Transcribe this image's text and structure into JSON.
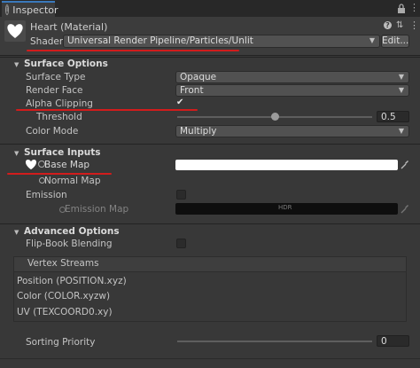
{
  "tab": {
    "title": "Inspector"
  },
  "header": {
    "material_name": "Heart (Material)",
    "shader_label": "Shader",
    "shader_value": "Universal Render Pipeline/Particles/Unlit",
    "edit_button": "Edit..."
  },
  "surface_options": {
    "title": "Surface Options",
    "surface_type_label": "Surface Type",
    "surface_type_value": "Opaque",
    "render_face_label": "Render Face",
    "render_face_value": "Front",
    "alpha_clipping_label": "Alpha Clipping",
    "alpha_clipping_checked": "✔",
    "threshold_label": "Threshold",
    "threshold_value": "0.5",
    "threshold_fraction": 0.5,
    "color_mode_label": "Color Mode",
    "color_mode_value": "Multiply"
  },
  "surface_inputs": {
    "title": "Surface Inputs",
    "base_map_label": "Base Map",
    "normal_map_label": "Normal Map",
    "emission_label": "Emission",
    "emission_map_label": "Emission Map",
    "hdr_label": "HDR"
  },
  "advanced_options": {
    "title": "Advanced Options",
    "flipbook_label": "Flip-Book Blending",
    "vertex_streams_title": "Vertex Streams",
    "streams": [
      "Position (POSITION.xyz)",
      "Color (COLOR.xyzw)",
      "UV (TEXCOORD0.xy)"
    ],
    "sorting_priority_label": "Sorting Priority",
    "sorting_priority_value": "0"
  },
  "colors": {
    "annotation": "#d21c1c",
    "tab_accent": "#3a79bb"
  },
  "icons": [
    "inspector-icon",
    "lock-icon",
    "menu-icon",
    "heart-icon",
    "help-icon",
    "preset-icon",
    "more-icon",
    "object-picker-icon",
    "eyedropper-icon"
  ]
}
